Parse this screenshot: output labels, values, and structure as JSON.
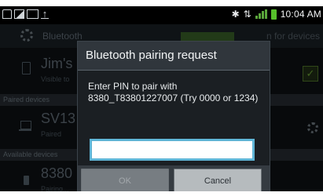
{
  "status_bar": {
    "time": "10:04 AM",
    "colors": {
      "signal": "#5aa63b",
      "battery": "#56c02b"
    }
  },
  "background": {
    "bluetooth_label": "Bluetooth",
    "scan_label": "n for devices",
    "my_device": {
      "name": "Jim's",
      "subtitle": "Visible to"
    },
    "paired_section": "Paired devices",
    "paired_device": {
      "name": "SV13",
      "subtitle": "Paired"
    },
    "available_section": "Available devices",
    "available_device": {
      "name": "8380",
      "subtitle": "Pairing..."
    }
  },
  "dialog": {
    "title": "Bluetooth pairing request",
    "message": "Enter PIN to pair with 8380_T83801227007 (Try 0000 or 1234)",
    "pin_value": "",
    "ok_label": "OK",
    "cancel_label": "Cancel",
    "accent": "#5fb5d6"
  }
}
